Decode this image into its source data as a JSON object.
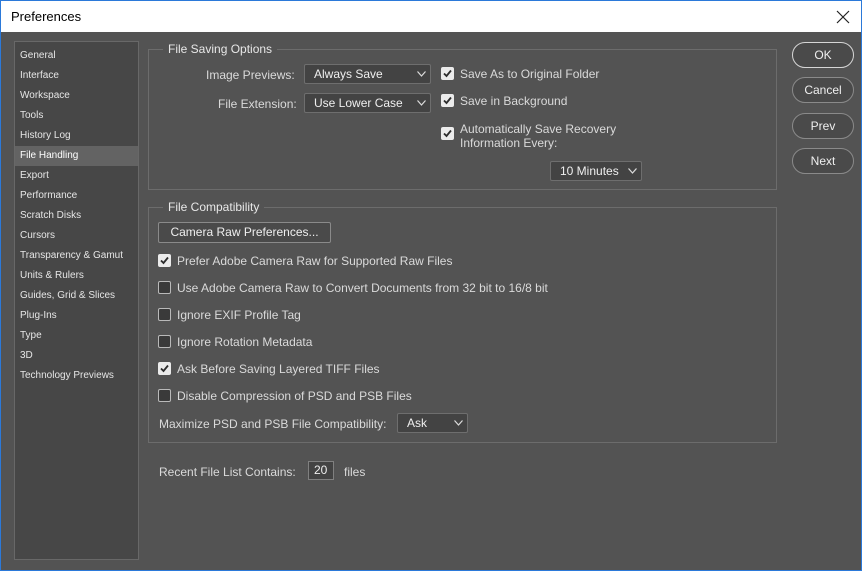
{
  "window": {
    "title": "Preferences"
  },
  "sidebar": {
    "items": [
      {
        "label": "General"
      },
      {
        "label": "Interface"
      },
      {
        "label": "Workspace"
      },
      {
        "label": "Tools"
      },
      {
        "label": "History Log"
      },
      {
        "label": "File Handling",
        "selected": true
      },
      {
        "label": "Export"
      },
      {
        "label": "Performance"
      },
      {
        "label": "Scratch Disks"
      },
      {
        "label": "Cursors"
      },
      {
        "label": "Transparency & Gamut"
      },
      {
        "label": "Units & Rulers"
      },
      {
        "label": "Guides, Grid & Slices"
      },
      {
        "label": "Plug-Ins"
      },
      {
        "label": "Type"
      },
      {
        "label": "3D"
      },
      {
        "label": "Technology Previews"
      }
    ]
  },
  "file_saving": {
    "title": "File Saving Options",
    "image_previews_label": "Image Previews:",
    "image_previews_value": "Always Save",
    "file_extension_label": "File Extension:",
    "file_extension_value": "Use Lower Case",
    "save_as_original": {
      "label": "Save As to Original Folder",
      "checked": true
    },
    "save_in_background": {
      "label": "Save in Background",
      "checked": true
    },
    "auto_save": {
      "label_line1": "Automatically Save Recovery",
      "label_line2": "Information Every:",
      "checked": true
    },
    "interval_value": "10 Minutes"
  },
  "file_compat": {
    "title": "File Compatibility",
    "camera_raw_button": "Camera Raw Preferences...",
    "options": [
      {
        "label": "Prefer Adobe Camera Raw for Supported Raw Files",
        "checked": true
      },
      {
        "label": "Use Adobe Camera Raw to Convert Documents from 32 bit to 16/8 bit",
        "checked": false
      },
      {
        "label": "Ignore EXIF Profile Tag",
        "checked": false
      },
      {
        "label": "Ignore Rotation Metadata",
        "checked": false
      },
      {
        "label": "Ask Before Saving Layered TIFF Files",
        "checked": true
      },
      {
        "label": "Disable Compression of PSD and PSB Files",
        "checked": false
      }
    ],
    "maximize_label": "Maximize PSD and PSB File Compatibility:",
    "maximize_value": "Ask"
  },
  "recent": {
    "label": "Recent File List Contains:",
    "value": "20",
    "suffix": "files"
  },
  "buttons": {
    "ok": "OK",
    "cancel": "Cancel",
    "prev": "Prev",
    "next": "Next"
  },
  "colors": {
    "background": "#535353",
    "sidebar_bg": "#474747",
    "selected_item": "#636363",
    "window_border": "#2b79d9"
  }
}
